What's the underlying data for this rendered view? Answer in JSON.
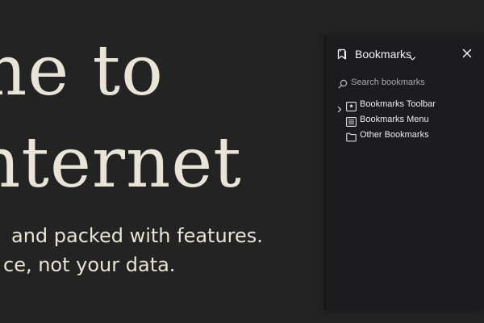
{
  "background": {
    "heading_lines": [
      "ne to",
      "nternet"
    ],
    "tagline_lines": [
      "and packed with features.",
      "ce, not your data."
    ]
  },
  "bookmarks_panel": {
    "title": "Bookmarks",
    "header_icon": "bookmark-icon",
    "switcher_icon": "chevron-down-icon",
    "close_icon": "close-icon",
    "search": {
      "placeholder": "Search bookmarks",
      "value": "",
      "icon": "search-icon"
    },
    "items": [
      {
        "label": "Bookmarks Toolbar",
        "icon": "bookmarks-toolbar-icon",
        "expandable": true
      },
      {
        "label": "Bookmarks Menu",
        "icon": "bookmarks-menu-icon",
        "expandable": false
      },
      {
        "label": "Other Bookmarks",
        "icon": "folder-icon",
        "expandable": false
      }
    ]
  },
  "colors": {
    "page_background": "#232323",
    "panel_background": "#1c1b1e",
    "heading_text": "#e9e4d6",
    "panel_text": "#ececef"
  }
}
